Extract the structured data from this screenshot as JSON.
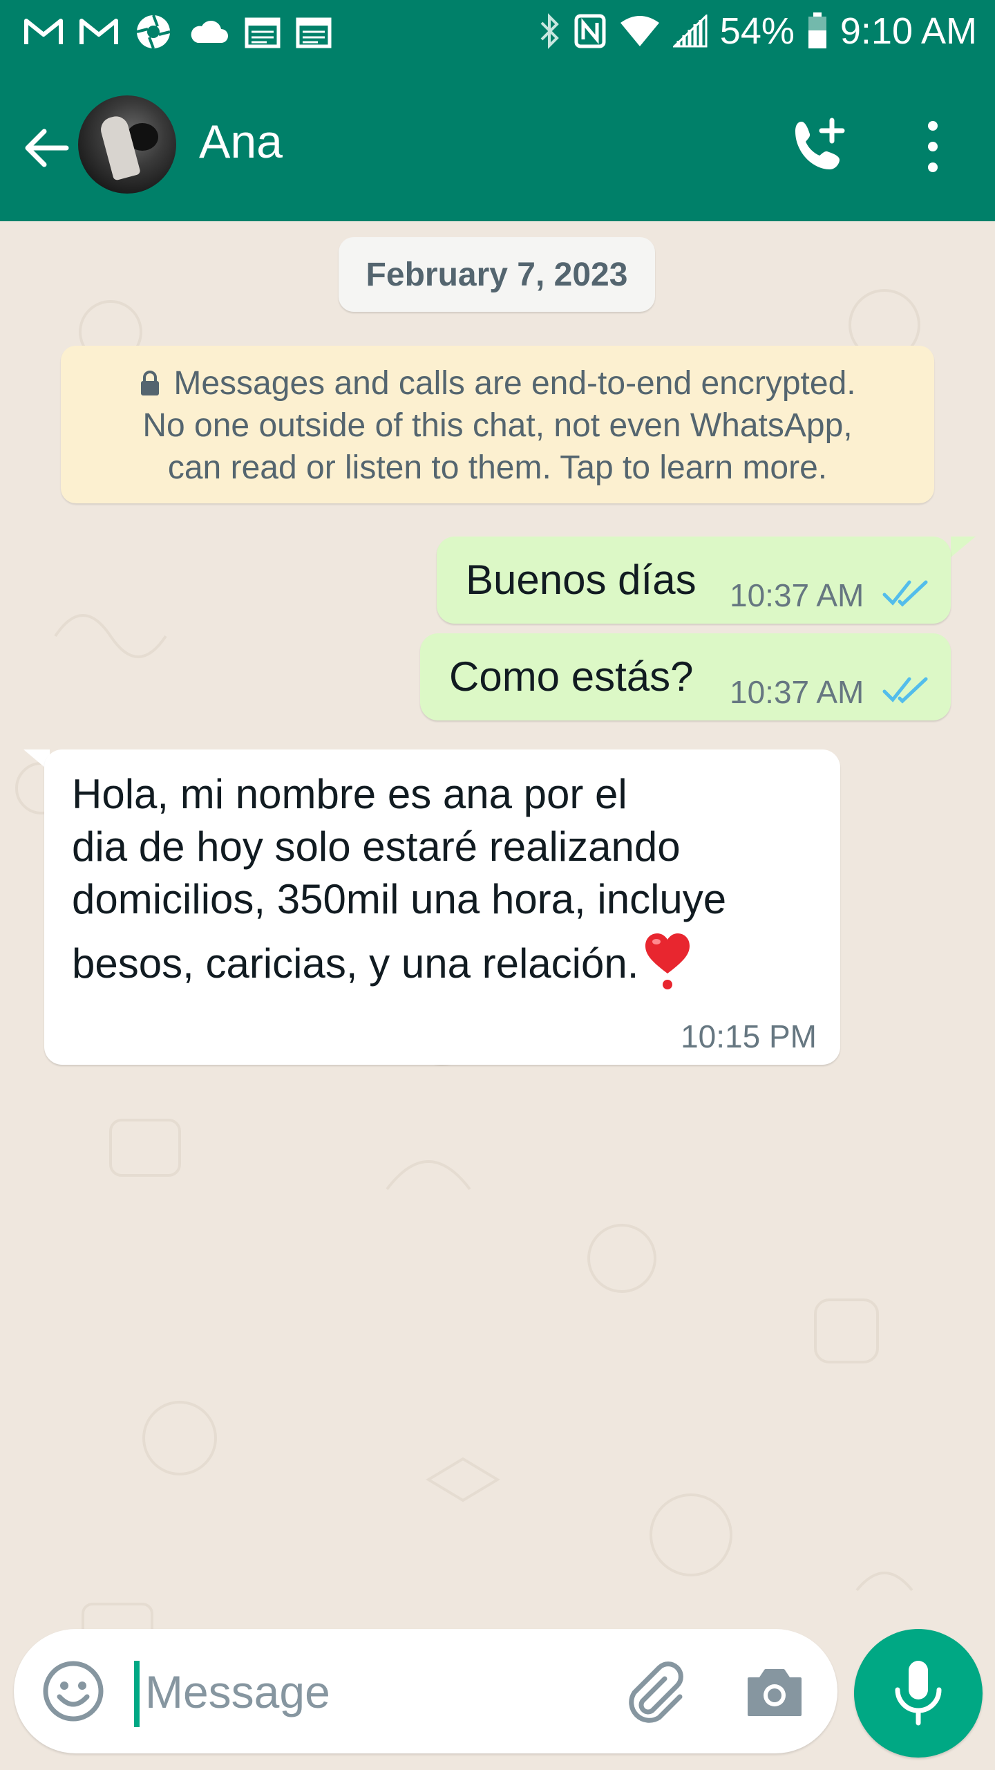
{
  "status_bar": {
    "battery": "54%",
    "time": "9:10 AM",
    "left_icons": [
      "gmail-icon",
      "gmail-icon",
      "aperture-icon",
      "cloud-icon",
      "calendar-icon",
      "calendar-icon"
    ],
    "right_icons": [
      "bluetooth-icon",
      "nfc-icon",
      "wifi-icon",
      "signal-icon",
      "battery-icon"
    ]
  },
  "header": {
    "contact_name": "Ana",
    "back_icon": "arrow-left-icon",
    "call_icon": "add-call-icon",
    "menu_icon": "more-vertical-icon",
    "bg_color": "#008069"
  },
  "chat": {
    "date": "February 7, 2023",
    "encryption_notice": {
      "line1": "Messages and calls are end-to-end encrypted.",
      "line2": "No one outside of this chat, not even WhatsApp,",
      "line3": "can read or listen to them. Tap to learn more."
    },
    "messages": [
      {
        "direction": "out",
        "text": "Buenos días",
        "time": "10:37 AM",
        "status": "read"
      },
      {
        "direction": "out",
        "text": "Como estás?",
        "time": "10:37 AM",
        "status": "read"
      },
      {
        "direction": "in",
        "lines": [
          "Hola, mi nombre es ana por el",
          "dia de hoy solo estaré realizando",
          "domicilios, 350mil una hora, incluye",
          "besos, caricias, y una relación."
        ],
        "emoji": "heart-icon",
        "time": "10:15 PM"
      }
    ]
  },
  "composer": {
    "placeholder": "Message",
    "emoji_icon": "smiley-icon",
    "attach_icon": "paperclip-icon",
    "camera_icon": "camera-icon",
    "mic_icon": "microphone-icon",
    "accent_color": "#00a884"
  }
}
